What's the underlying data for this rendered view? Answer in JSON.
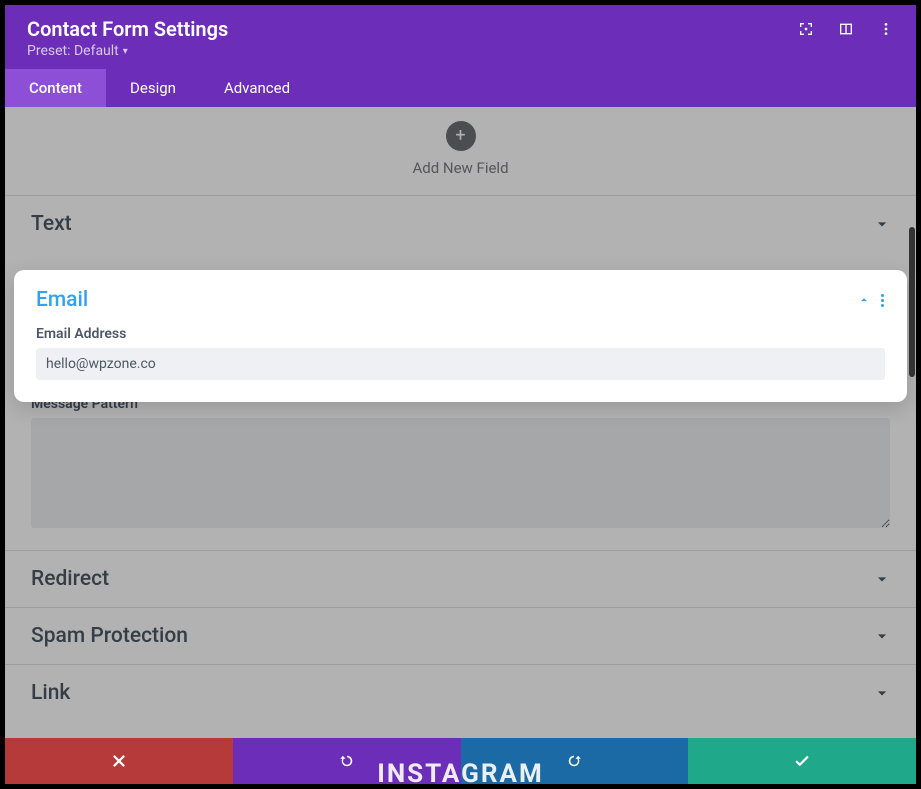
{
  "header": {
    "title": "Contact Form Settings",
    "preset": "Preset: Default"
  },
  "tabs": {
    "content": "Content",
    "design": "Design",
    "advanced": "Advanced"
  },
  "addField": {
    "label": "Add New Field"
  },
  "sections": {
    "text": {
      "title": "Text"
    },
    "email": {
      "title": "Email",
      "field_label": "Email Address",
      "field_value": "hello@wpzone.co"
    },
    "messagePattern": {
      "label": "Message Pattern",
      "value": ""
    },
    "redirect": {
      "title": "Redirect"
    },
    "spam": {
      "title": "Spam Protection"
    },
    "link": {
      "title": "Link"
    }
  },
  "bgText": "INSTAGRAM"
}
